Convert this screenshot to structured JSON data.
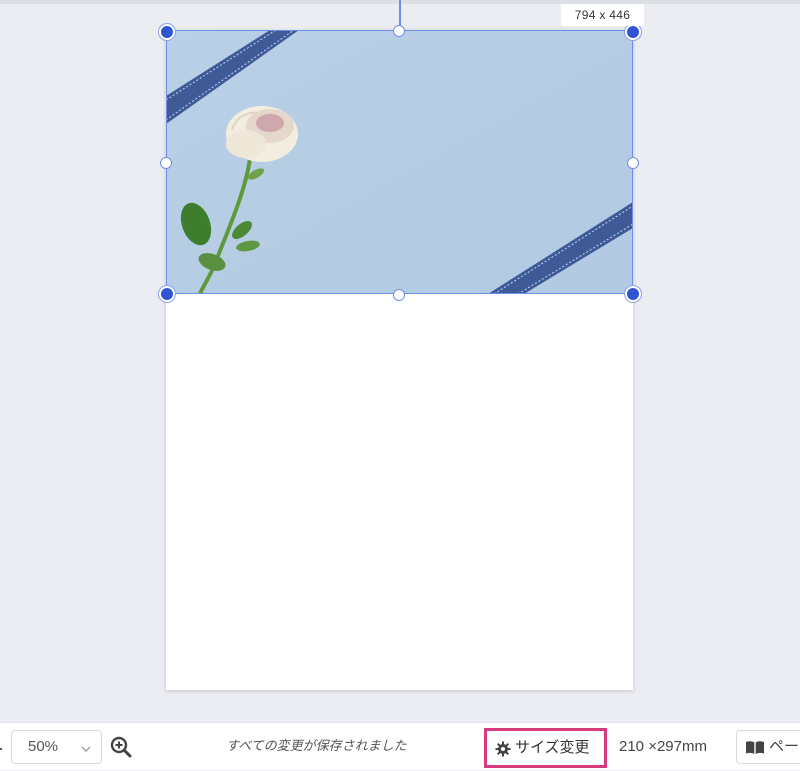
{
  "canvas": {
    "selection_size_label": "794 x 446"
  },
  "image": {
    "subject": "white rose on light blue background with navy ribbons",
    "background_color": "#b7cfe6",
    "ribbon_color": "#3e5b98"
  },
  "toolbar": {
    "zoom_value": "50%",
    "save_status": "すべての変更が保存されました",
    "resize_label": "サイズ変更",
    "page_size": "210 ×297mm",
    "pages_label": "ペー"
  },
  "colors": {
    "selection": "#6f8fe6",
    "handle": "#2f55d4",
    "highlight": "#d63b7d"
  },
  "icons": {
    "zoom_in": "zoom-in-icon",
    "chevron": "chevron-down-icon",
    "gear": "gear-icon",
    "book": "book-icon"
  }
}
